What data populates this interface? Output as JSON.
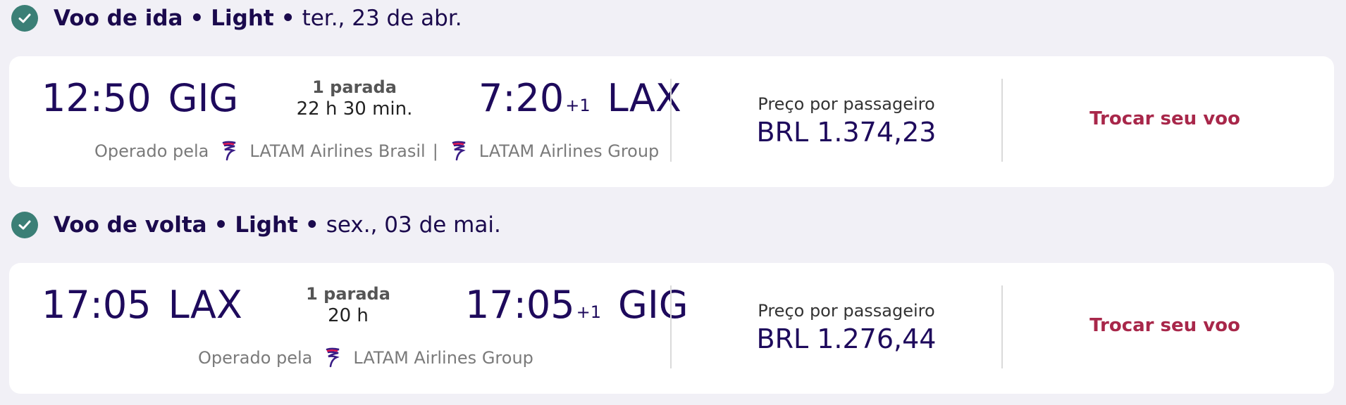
{
  "outbound": {
    "header": {
      "title": "Voo de ida",
      "separator_1": "•",
      "fare": "Light",
      "separator_2": "•",
      "date": "ter., 23 de abr."
    },
    "departure": {
      "time": "12:50",
      "airport": "GIG"
    },
    "arrival": {
      "time": "7:20",
      "day_offset": "+1",
      "airport": "LAX"
    },
    "stops": "1 parada",
    "duration": "22 h 30 min.",
    "operated_by_label": "Operado pela",
    "operators": [
      "LATAM Airlines Brasil",
      "LATAM Airlines Group"
    ],
    "operator_separator": "|",
    "price_label": "Preço por passageiro",
    "price": "BRL 1.374,23",
    "change_label": "Trocar seu voo"
  },
  "return": {
    "header": {
      "title": "Voo de volta",
      "separator_1": "•",
      "fare": "Light",
      "separator_2": "•",
      "date": "sex., 03 de mai."
    },
    "departure": {
      "time": "17:05",
      "airport": "LAX"
    },
    "arrival": {
      "time": "17:05",
      "day_offset": "+1",
      "airport": "GIG"
    },
    "stops": "1 parada",
    "duration": "20 h",
    "operated_by_label": "Operado pela",
    "operators": [
      "LATAM Airlines Group"
    ],
    "price_label": "Preço por passageiro",
    "price": "BRL 1.276,44",
    "change_label": "Trocar seu voo"
  },
  "colors": {
    "background": "#f1f0f6",
    "check_badge": "#3b7f76",
    "navy_text": "#1e0a5c",
    "link_red": "#a8274a"
  },
  "icons": [
    "check-circle-icon",
    "latam-logo-icon"
  ]
}
